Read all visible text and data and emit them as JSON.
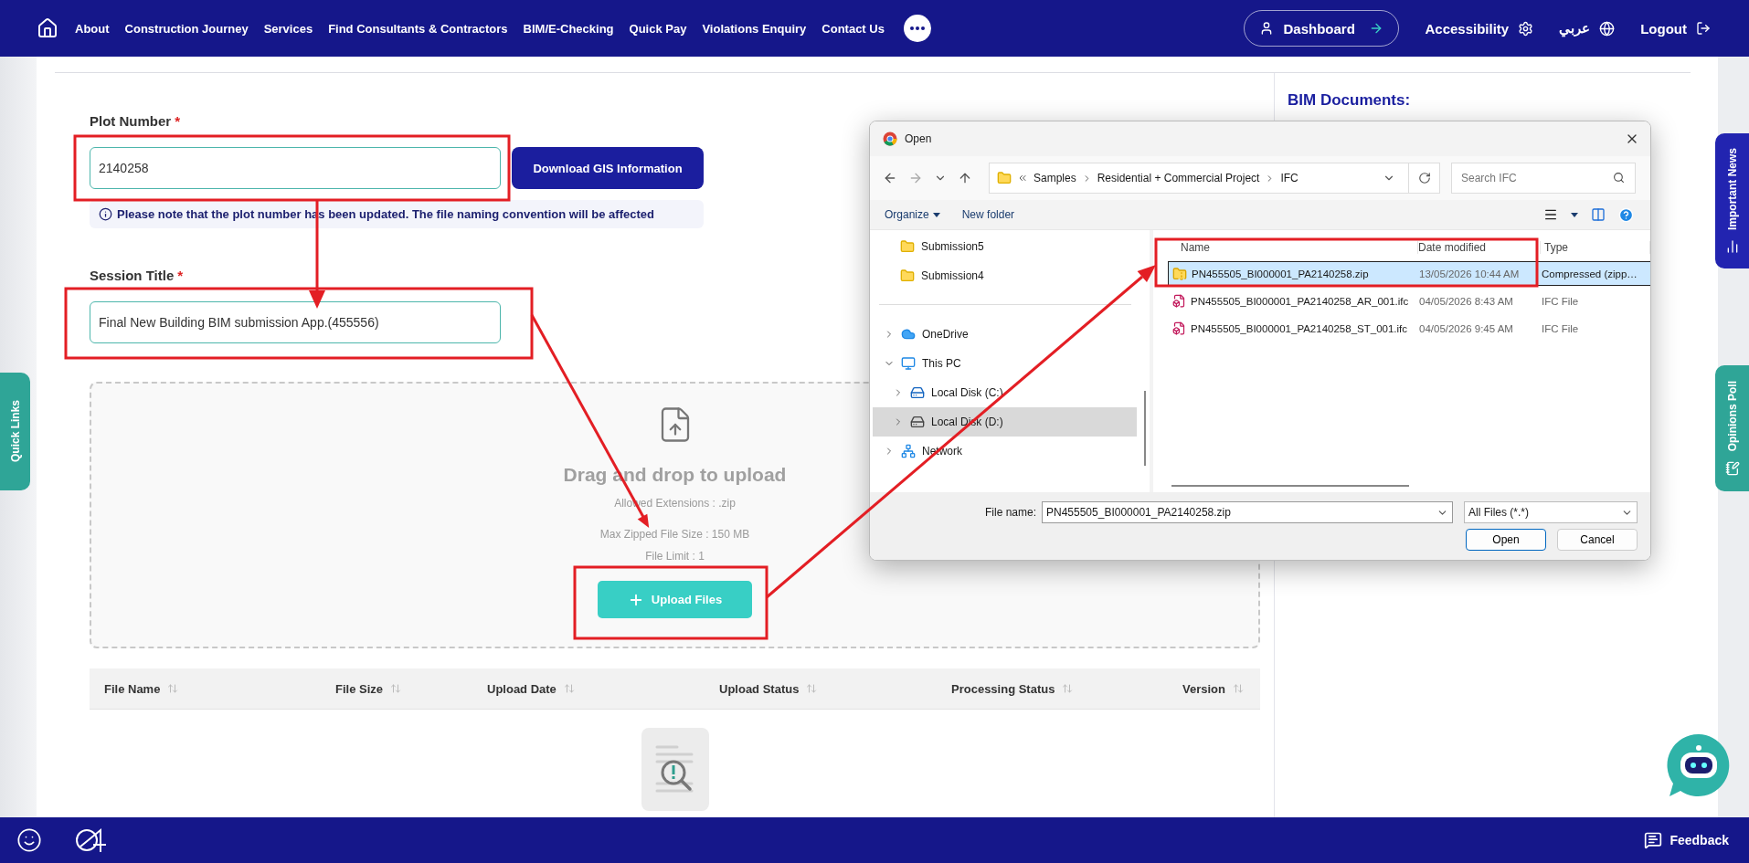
{
  "nav": {
    "items": [
      "About",
      "Construction Journey",
      "Services",
      "Find Consultants & Contractors",
      "BIM/E-Checking",
      "Quick Pay",
      "Violations Enquiry",
      "Contact Us"
    ],
    "dashboard": "Dashboard",
    "accessibility": "Accessibility",
    "language": "عربي",
    "logout": "Logout"
  },
  "form": {
    "plot": {
      "label": "Plot Number",
      "mark": "*",
      "value": "2140258"
    },
    "gis_button": "Download GIS Information",
    "note": "Please note that the plot number has been updated. The file naming convention will be affected",
    "session": {
      "label": "Session Title",
      "mark": "*",
      "value": "Final New Building BIM submission App.(455556)"
    }
  },
  "dropzone": {
    "title": "Drag and drop to upload",
    "lines": [
      "Allowed Extensions : .zip",
      "Max Zipped File Size : 150 MB",
      "File Limit : 1"
    ],
    "button": "Upload Files"
  },
  "table": {
    "columns": [
      "File Name",
      "File Size",
      "Upload Date",
      "Upload Status",
      "Processing Status",
      "Version"
    ]
  },
  "side": {
    "title": "BIM Documents:"
  },
  "side_tabs": {
    "left": "Quick Links",
    "right": [
      "Important News",
      "Opinions Poll"
    ]
  },
  "footer": {
    "feedback": "Feedback"
  },
  "dialog": {
    "title": "Open",
    "path": [
      "Samples",
      "Residential + Commercial Project",
      "IFC"
    ],
    "search_placeholder": "Search IFC",
    "toolbar": [
      "Organize",
      "New folder"
    ],
    "quick_access": [
      "Submission5",
      "Submission4"
    ],
    "tree": [
      {
        "label": "OneDrive",
        "kind": "cloud",
        "expanded": false,
        "selected": false
      },
      {
        "label": "This PC",
        "kind": "pc",
        "expanded": true,
        "selected": false,
        "children": [
          {
            "label": "Local Disk (C:)",
            "kind": "system-disk",
            "expanded": false,
            "selected": false
          },
          {
            "label": "Local Disk (D:)",
            "kind": "disk",
            "expanded": false,
            "selected": true
          }
        ]
      },
      {
        "label": "Network",
        "kind": "network",
        "expanded": false,
        "selected": false
      }
    ],
    "columns": [
      "Name",
      "Date modified",
      "Type"
    ],
    "files": [
      {
        "name": "PN455505_BI000001_PA2140258.zip",
        "date": "13/05/2026 10:44 AM",
        "type": "Compressed (zipp…",
        "kind": "zip",
        "selected": true
      },
      {
        "name": "PN455505_BI000001_PA2140258_AR_001.ifc",
        "date": "04/05/2026 8:43 AM",
        "type": "IFC File",
        "kind": "ifc",
        "selected": false
      },
      {
        "name": "PN455505_BI000001_PA2140258_ST_001.ifc",
        "date": "04/05/2026 9:45 AM",
        "type": "IFC File",
        "kind": "ifc",
        "selected": false
      }
    ],
    "file_name_label": "File name:",
    "file_name": "PN455505_BI000001_PA2140258.zip",
    "filter": "All Files (*.*)",
    "buttons": [
      "Open",
      "Cancel"
    ]
  }
}
